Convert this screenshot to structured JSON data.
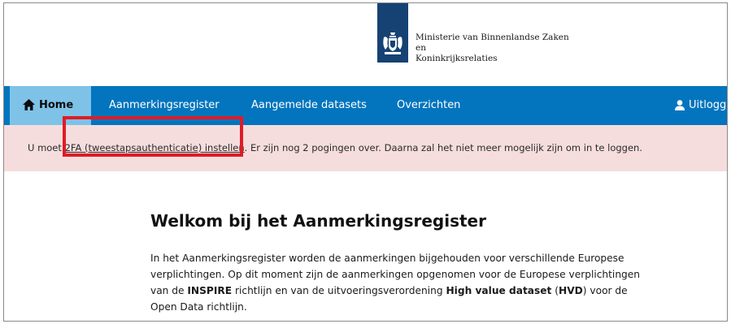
{
  "header": {
    "logo_line1": "Ministerie van Binnenlandse Zaken en",
    "logo_line2": "Koninkrijksrelaties",
    "logo_icon": "coat-of-arms"
  },
  "nav": {
    "home": "Home",
    "register": "Aanmerkingsregister",
    "datasets": "Aangemelde datasets",
    "overviews": "Overzichten",
    "logout": "Uitlogg"
  },
  "alert": {
    "prefix": "U moet ",
    "link": "2FA (tweestapsauthenticatie) instellen",
    "suffix": ". Er zijn nog 2 pogingen over. Daarna zal het niet meer mogelijk zijn om in te loggen."
  },
  "main": {
    "title": "Welkom bij het Aanmerkingsregister",
    "p1": "In het Aanmerkingsregister worden de aanmerkingen bijgehouden voor verschillende Europese verplichtingen. Op dit moment zijn de aanmerkingen opgenomen voor de Europese verplichtingen van de ",
    "inspire": "INSPIRE",
    "p2": " richtlijn en van de uitvoeringsverordening ",
    "hvd_long": "High value dataset",
    "p3": " (",
    "hvd": "HVD",
    "p4": ") voor de Open Data richtlijn."
  },
  "colors": {
    "nav_bg": "#0375be",
    "home_bg": "#7ec2e8",
    "alert_bg": "#f6dddd",
    "logo_bg": "#154273",
    "highlight": "#e01b24"
  }
}
